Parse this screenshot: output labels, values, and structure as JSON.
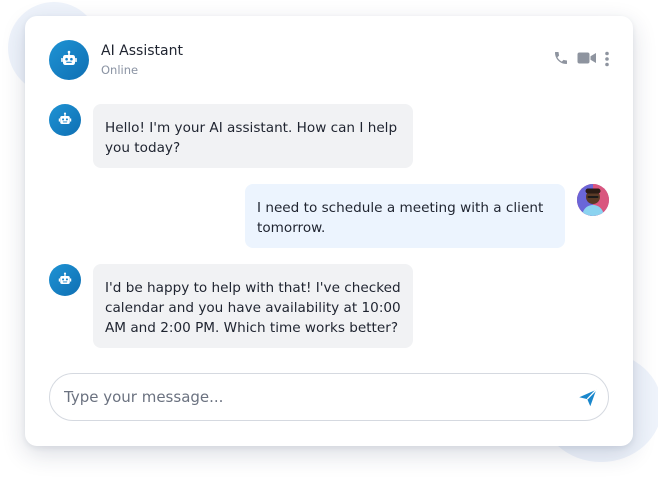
{
  "header": {
    "title": "AI Assistant",
    "status": "Online",
    "avatar_icon": "robot-icon",
    "actions": [
      "phone-icon",
      "video-icon",
      "more-vertical-icon"
    ]
  },
  "messages": [
    {
      "sender": "bot",
      "text": "Hello! I'm your AI assistant. How can I help you today?"
    },
    {
      "sender": "user",
      "text": "I need to schedule a meeting with a client tomorrow."
    },
    {
      "sender": "bot",
      "text": "I'd be happy to help with that! I've checked calendar and you have availability at 10:00 AM and 2:00 PM. Which time works better?"
    }
  ],
  "composer": {
    "placeholder": "Type your message...",
    "send_icon": "send-icon"
  },
  "colors": {
    "accent": "#1a87cc",
    "bot_bubble": "#f1f2f4",
    "user_bubble": "#ecf4fe",
    "text": "#1f2430",
    "muted": "#8a93a3"
  }
}
